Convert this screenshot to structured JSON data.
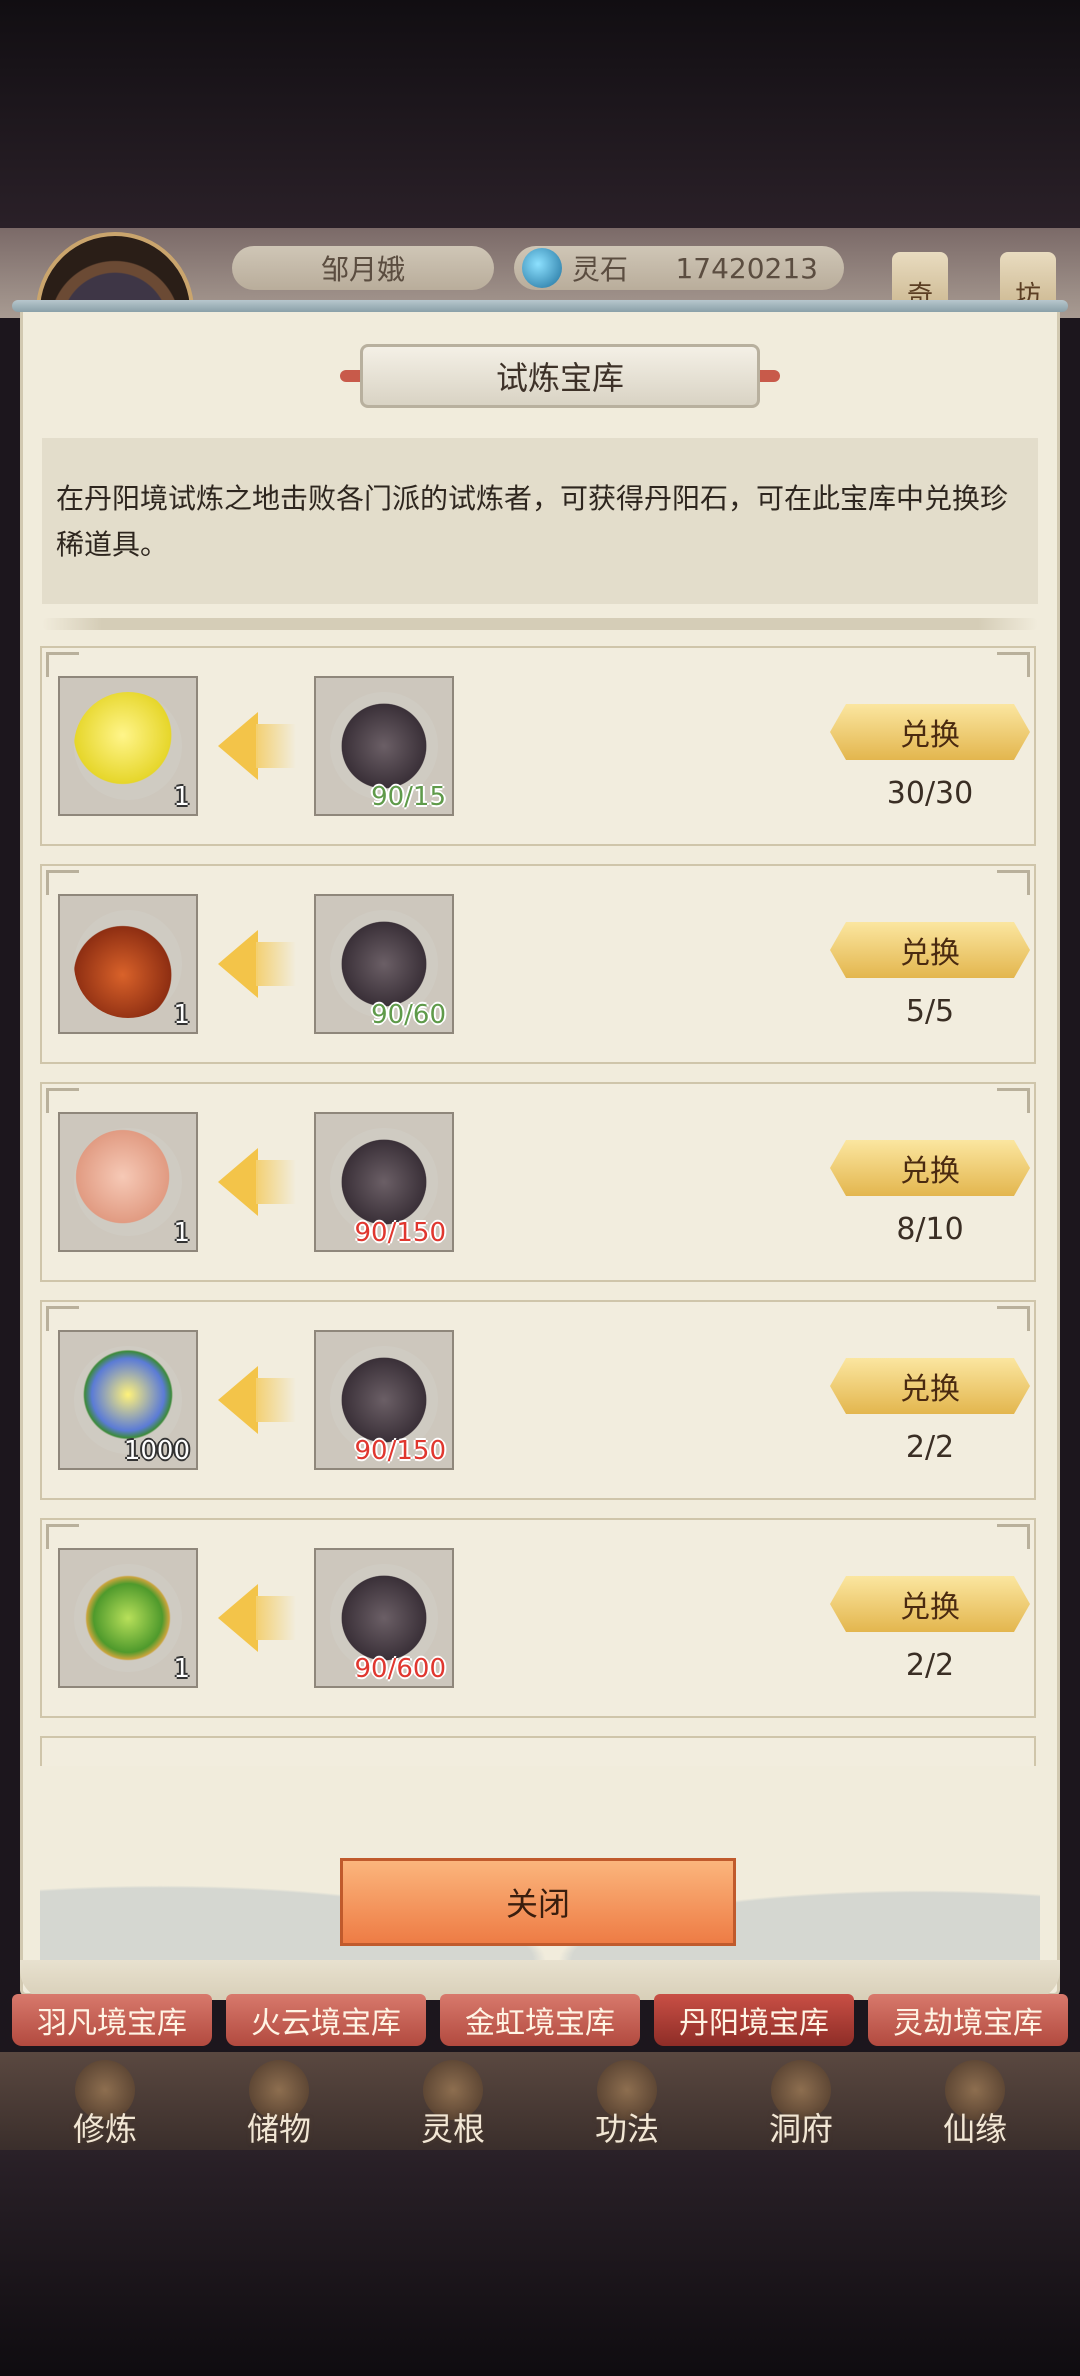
{
  "header": {
    "player_name": "邹月娥",
    "currency_label": "灵石",
    "currency_value": "17420213",
    "side_tabs": [
      "奇",
      "坊"
    ]
  },
  "dialog": {
    "title": "试炼宝库",
    "description": "在丹阳境试炼之地击败各门派的试炼者，可获得丹阳石，可在此宝库中兑换珍稀道具。",
    "items": [
      {
        "reward_count": "1",
        "cost": "90/15",
        "cost_color": "#5f9a4a",
        "button": "兑换",
        "limit": "30/30"
      },
      {
        "reward_count": "1",
        "cost": "90/60",
        "cost_color": "#5f9a4a",
        "button": "兑换",
        "limit": "5/5"
      },
      {
        "reward_count": "1",
        "cost": "90/150",
        "cost_color": "#e0372f",
        "button": "兑换",
        "limit": "8/10"
      },
      {
        "reward_count": "1000",
        "cost": "90/150",
        "cost_color": "#e0372f",
        "button": "兑换",
        "limit": "2/2"
      },
      {
        "reward_count": "1",
        "cost": "90/600",
        "cost_color": "#e0372f",
        "button": "兑换",
        "limit": "2/2"
      }
    ],
    "close_label": "关闭"
  },
  "vault_tabs": [
    "羽凡境宝库",
    "火云境宝库",
    "金虹境宝库",
    "丹阳境宝库",
    "灵劫境宝库"
  ],
  "active_vault_tab": 3,
  "bottom_nav": [
    "修炼",
    "储物",
    "灵根",
    "功法",
    "洞府",
    "仙缘"
  ]
}
